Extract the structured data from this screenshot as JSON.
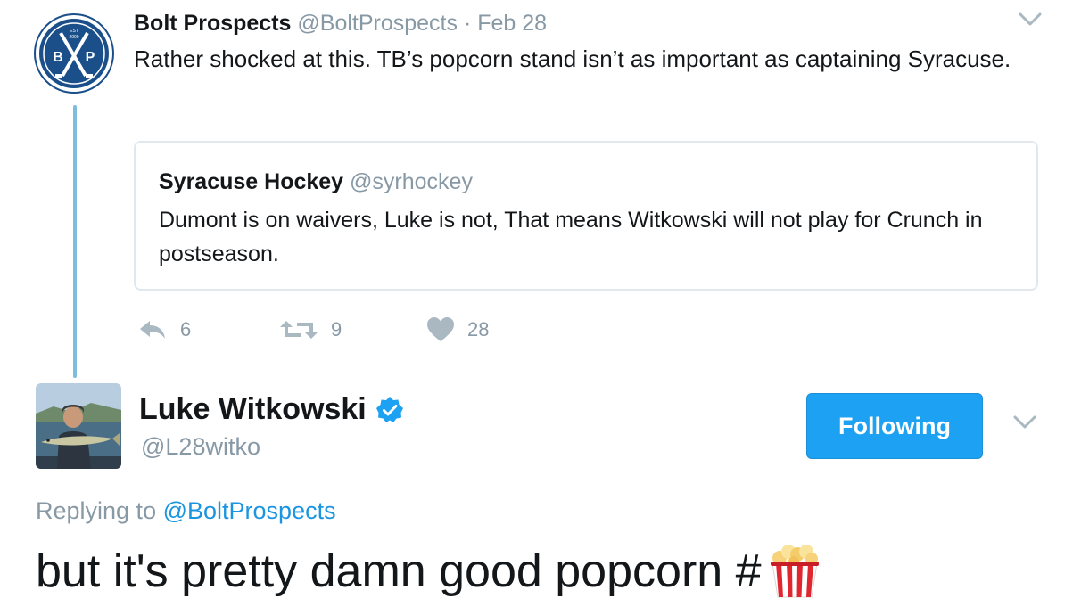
{
  "original_tweet": {
    "author_name": "Bolt Prospects",
    "handle": "@BoltProspects",
    "separator": "·",
    "date": "Feb 28",
    "text": "Rather shocked at this. TB’s popcorn stand isn’t as important as captaining Syracuse.",
    "avatar": {
      "icon": "hockey-sticks-logo-icon",
      "top_text": "EST",
      "year_text": "2009",
      "letter_left": "B",
      "letter_right": "P",
      "color": "#1a4f8a"
    },
    "quoted_tweet": {
      "author_name": "Syracuse Hockey",
      "handle": "@syrhockey",
      "text": "Dumont is on waivers, Luke is not, That means Witkowski will not play for Crunch in postseason."
    },
    "actions": {
      "reply_count": "6",
      "retweet_count": "9",
      "like_count": "28"
    }
  },
  "reply": {
    "author_name": "Luke Witkowski",
    "handle": "@L28witko",
    "verified": true,
    "follow_button_label": "Following",
    "replying_prefix": "Replying to",
    "replying_handle": "@BoltProspects",
    "text": "but it's pretty damn good popcorn #",
    "emoji": "popcorn-emoji"
  },
  "colors": {
    "link_blue": "#1b95e0",
    "button_blue": "#1da1f2",
    "muted_gray": "#8899a6",
    "thread_line": "#7fbde0"
  }
}
